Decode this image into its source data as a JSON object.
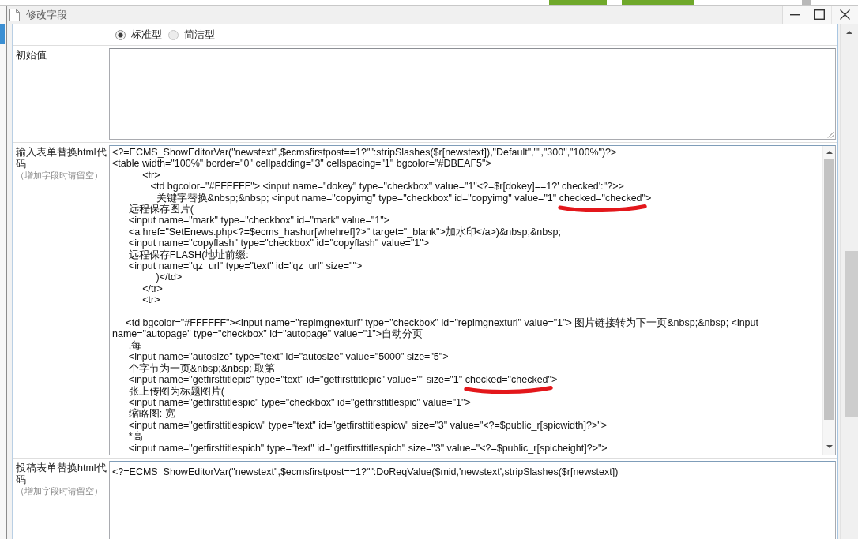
{
  "window": {
    "title": "修改字段",
    "controls": [
      {
        "kind": "minimize"
      },
      {
        "kind": "maximize"
      },
      {
        "kind": "close"
      }
    ]
  },
  "form": {
    "rows": [
      {
        "kind": "radios",
        "options": [
          {
            "label": "标准型",
            "selected": true
          },
          {
            "label": "简洁型",
            "selected": false
          }
        ]
      },
      {
        "kind": "textarea",
        "label": "初始值"
      },
      {
        "kind": "code",
        "label": "输入表单替换html代码",
        "hint": "（增加字段时请留空）",
        "scrollbar": true,
        "blocks": [
          {
            "lines": [
              {
                "text": "<?=ECMS_ShowEditorVar(\"newstext\",$ecmsfirstpost==1?\"\":stripSlashes($r[newstext]),\"Default\",\"\",\"300\",\"100%\")?>"
              },
              {
                "text": "<table width=\"100%\" border=\"0\" cellpadding=\"3\" cellspacing=\"1\" bgcolor=\"#DBEAF5\">"
              },
              {
                "text": "           <tr>"
              },
              {
                "text": "              <td bgcolor=\"#FFFFFF\"> <input name=\"dokey\" type=\"checkbox\" value=\"1\"<?=$r[dokey]==1?' checked':''?>>"
              },
              {
                "text": "                关键字替换&nbsp;&nbsp; <input name=\"copyimg\" type=\"checkbox\" id=\"copyimg\" value=\"1\" ",
                "underlined": "checked=\"checked\"",
                "after": ">"
              },
              {
                "text": "      远程保存图片("
              },
              {
                "text": "      <input name=\"mark\" type=\"checkbox\" id=\"mark\" value=\"1\">"
              },
              {
                "text": "      <a href=\"SetEnews.php<?=$ecms_hashur[whehref]?>\" target=\"_blank\">加水印</a>)&nbsp;&nbsp;"
              },
              {
                "text": "      <input name=\"copyflash\" type=\"checkbox\" id=\"copyflash\" value=\"1\">"
              },
              {
                "text": "      远程保存FLASH(地址前缀:"
              },
              {
                "text": "      <input name=\"qz_url\" type=\"text\" id=\"qz_url\" size=\"\">"
              },
              {
                "text": "                )</td>"
              },
              {
                "text": "           </tr>"
              },
              {
                "text": "           <tr>"
              }
            ]
          },
          {
            "lines": [
              {
                "text": "     <td bgcolor=\"#FFFFFF\"><input name=\"repimgnexturl\" type=\"checkbox\" id=\"repimgnexturl\" value=\"1\"> 图片链接转为下一页&nbsp;&nbsp; <input"
              },
              {
                "text": "name=\"autopage\" type=\"checkbox\" id=\"autopage\" value=\"1\">自动分页"
              },
              {
                "text": "      ,每"
              },
              {
                "text": "      <input name=\"autosize\" type=\"text\" id=\"autosize\" value=\"5000\" size=\"5\">"
              },
              {
                "text": "      个字节为一页&nbsp;&nbsp; 取第"
              },
              {
                "text": "      <input name=\"getfirsttitlepic\" type=\"text\" id=\"getfirsttitlepic\" value=\"\" size=\"1\" ",
                "underlined": "checked=\"checked\"",
                "after": ">"
              },
              {
                "text": "      张上传图为标题图片("
              },
              {
                "text": "      <input name=\"getfirsttitlespic\" type=\"checkbox\" id=\"getfirsttitlespic\" value=\"1\">"
              },
              {
                "text": "      缩略图: 宽"
              },
              {
                "text": "      <input name=\"getfirsttitlespicw\" type=\"text\" id=\"getfirsttitlespicw\" size=\"3\" value=\"<?=$public_r[spicwidth]?>\">"
              },
              {
                "text": "      *高"
              },
              {
                "text": "      <input name=\"getfirsttitlespich\" type=\"text\" id=\"getfirsttitlespich\" size=\"3\" value=\"<?=$public_r[spicheight]?>\">"
              }
            ]
          }
        ]
      },
      {
        "kind": "code",
        "label": "投稿表单替换html代码",
        "hint": "（增加字段时请留空）",
        "blocks": [
          {
            "lines": [
              {
                "text": "<?=ECMS_ShowEditorVar(\"newstext\",$ecmsfirstpost==1?\"\":DoReqValue($mid,'newstext',stripSlashes($r[newstext])"
              }
            ]
          }
        ]
      }
    ]
  }
}
